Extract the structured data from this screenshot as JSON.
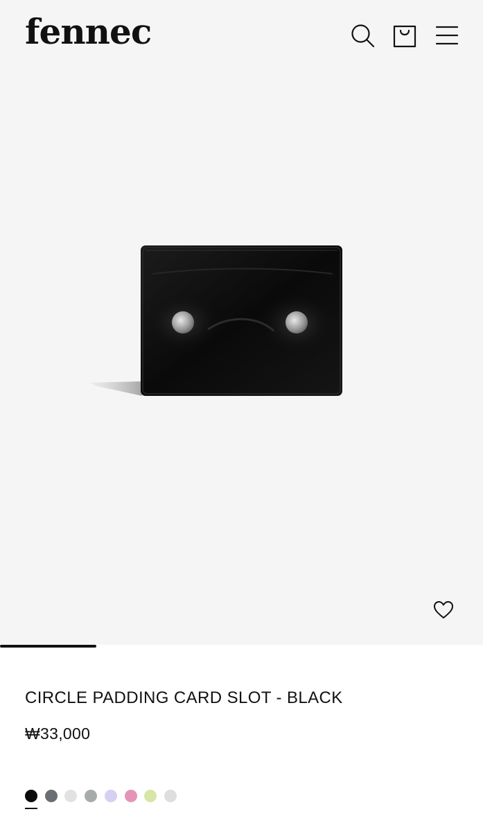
{
  "brand": {
    "name": "fennec"
  },
  "header": {
    "icons": [
      "search-icon",
      "shopping-bag-icon",
      "menu-icon"
    ]
  },
  "gallery": {
    "background": "#f5f5f5",
    "wishlist_icon": "heart-outline-icon",
    "progress": 0.2
  },
  "product": {
    "title": "CIRCLE PADDING CARD SLOT - BLACK",
    "price": "₩33,000"
  },
  "colors": {
    "selected_index": 0,
    "swatches": [
      "#0b0b0b",
      "#6b6e72",
      "#e2e2e2",
      "#a7aca9",
      "#d6d0f2",
      "#e594b8",
      "#d6e6a6",
      "#dedede"
    ]
  }
}
